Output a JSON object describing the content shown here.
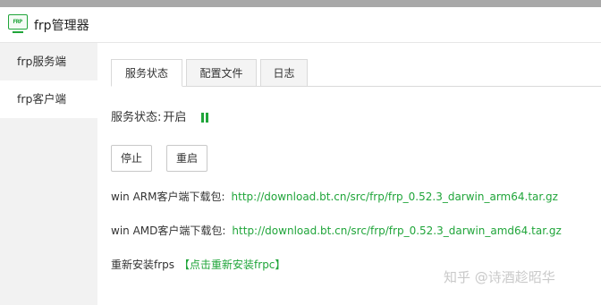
{
  "app": {
    "title": "frp管理器",
    "logo_text": "FRP",
    "logo_icon": "monitor-frp-icon"
  },
  "sidebar": {
    "items": [
      {
        "label": "frp服务端",
        "active": false
      },
      {
        "label": "frp客户端",
        "active": true
      }
    ]
  },
  "tabs": [
    {
      "label": "服务状态",
      "active": true
    },
    {
      "label": "配置文件",
      "active": false
    },
    {
      "label": "日志",
      "active": false
    }
  ],
  "status": {
    "label": "服务状态:",
    "value": "开启",
    "indicator_icon": "running-indicator-icon"
  },
  "buttons": {
    "stop": "停止",
    "restart": "重启"
  },
  "downloads": {
    "arm": {
      "label": "win ARM客户端下载包:",
      "url": "http://download.bt.cn/src/frp/frp_0.52.3_darwin_arm64.tar.gz"
    },
    "amd": {
      "label": "win AMD客户端下载包:",
      "url": "http://download.bt.cn/src/frp/frp_0.52.3_darwin_amd64.tar.gz"
    }
  },
  "reinstall": {
    "label": "重新安装frps",
    "link": "【点击重新安装frpc】"
  },
  "watermark": "知乎 @诗酒趁昭华",
  "colors": {
    "accent": "#20a53a",
    "sidebar_bg": "#f2f2f2",
    "topbar": "#a8a8a8"
  }
}
